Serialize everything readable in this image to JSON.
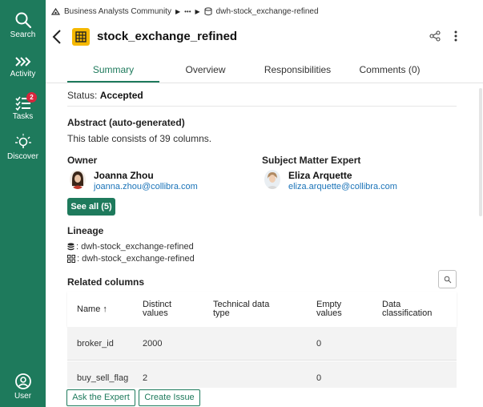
{
  "nav": {
    "items": [
      {
        "label": "Search",
        "icon": "search-icon"
      },
      {
        "label": "Activity",
        "icon": "chevrons-icon"
      },
      {
        "label": "Tasks",
        "icon": "tasks-icon",
        "badge": "2"
      },
      {
        "label": "Discover",
        "icon": "lightbulb-icon"
      },
      {
        "label": "User",
        "icon": "user-icon"
      }
    ],
    "color": "#1e7a5c"
  },
  "breadcrumb": {
    "community": "Business Analysts Community",
    "ellipsis": "•••",
    "current": "dwh-stock_exchange-refined"
  },
  "header": {
    "title": "stock_exchange_refined",
    "icon_color": "#f5b800"
  },
  "tabs": [
    {
      "label": "Summary",
      "active": true
    },
    {
      "label": "Overview",
      "active": false
    },
    {
      "label": "Responsibilities",
      "active": false
    },
    {
      "label": "Comments (0)",
      "active": false
    }
  ],
  "summary": {
    "status_label": "Status:",
    "status_value": "Accepted",
    "abstract_heading": "Abstract (auto-generated)",
    "abstract_text": "This table consists of 39 columns.",
    "owner_heading": "Owner",
    "owner_name": "Joanna Zhou",
    "owner_email": "joanna.zhou@collibra.com",
    "sme_heading": "Subject Matter Expert",
    "sme_name": "Eliza Arquette",
    "sme_email": "eliza.arquette@collibra.com",
    "see_all": "See all (5)",
    "lineage_heading": "Lineage",
    "lineage_items": [
      {
        "text": ": dwh-stock_exchange-refined",
        "icon": "database-icon"
      },
      {
        "text": ": dwh-stock_exchange-refined",
        "icon": "schema-icon"
      }
    ],
    "related_heading": "Related columns"
  },
  "table": {
    "columns": [
      {
        "line1": "Name ↑",
        "line2": ""
      },
      {
        "line1": "Distinct",
        "line2": "values"
      },
      {
        "line1": "Technical data",
        "line2": "type"
      },
      {
        "line1": "Empty",
        "line2": "values"
      },
      {
        "line1": "Data",
        "line2": "classification"
      }
    ],
    "rows": [
      {
        "name": "broker_id",
        "distinct": "2000",
        "type": "",
        "empty": "0",
        "classification": ""
      },
      {
        "name": "buy_sell_flag",
        "distinct": "2",
        "type": "",
        "empty": "0",
        "classification": ""
      }
    ]
  },
  "footer": {
    "ask_expert": "Ask the Expert",
    "create_issue": "Create Issue"
  }
}
